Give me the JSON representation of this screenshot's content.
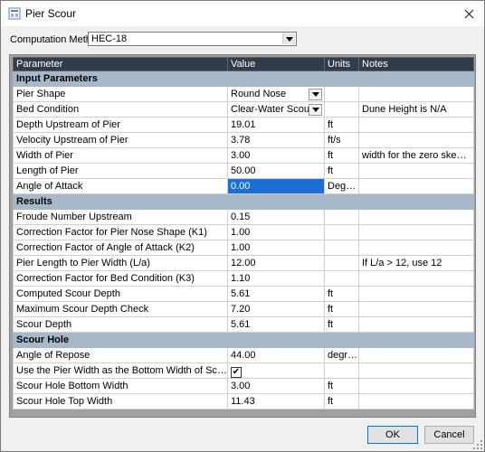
{
  "window": {
    "title": "Pier Scour"
  },
  "icons": {
    "app": "app-icon",
    "close": "close-icon",
    "dropdown": "chevron-down-icon",
    "check": "check-icon",
    "grip": "resize-grip-icon"
  },
  "computation": {
    "label": "Computation Method:",
    "value": "HEC-18"
  },
  "grid": {
    "headers": {
      "parameter": "Parameter",
      "value": "Value",
      "units": "Units",
      "notes": "Notes"
    },
    "sections": {
      "input": "Input Parameters",
      "results": "Results",
      "scour_hole": "Scour Hole"
    },
    "rows": {
      "pier_shape": {
        "p": "Pier Shape",
        "v": "Round Nose",
        "u": "",
        "n": ""
      },
      "bed_condition": {
        "p": "Bed Condition",
        "v": "Clear-Water Scour",
        "u": "",
        "n": "Dune Height is N/A"
      },
      "depth_upstream": {
        "p": "Depth Upstream of Pier",
        "v": "19.01",
        "u": "ft",
        "n": ""
      },
      "velocity_upstream": {
        "p": "Velocity Upstream of Pier",
        "v": "3.78",
        "u": "ft/s",
        "n": ""
      },
      "width_of_pier": {
        "p": "Width of Pier",
        "v": "3.00",
        "u": "ft",
        "n": "width for the zero skew co..."
      },
      "length_of_pier": {
        "p": "Length of Pier",
        "v": "50.00",
        "u": "ft",
        "n": ""
      },
      "angle_of_attack": {
        "p": "Angle of Attack",
        "v": "0.00",
        "u": "Degrees",
        "n": ""
      },
      "froude": {
        "p": "Froude Number Upstream",
        "v": "0.15",
        "u": "",
        "n": ""
      },
      "k1": {
        "p": "Correction Factor for Pier Nose Shape (K1)",
        "v": "1.00",
        "u": "",
        "n": ""
      },
      "k2": {
        "p": "Correction Factor of Angle of Attack (K2)",
        "v": "1.00",
        "u": "",
        "n": ""
      },
      "la": {
        "p": "Pier Length to Pier Width (L/a)",
        "v": "12.00",
        "u": "",
        "n": "If L/a > 12, use 12"
      },
      "k3": {
        "p": "Correction Factor for Bed Condition (K3)",
        "v": "1.10",
        "u": "",
        "n": ""
      },
      "computed_scour": {
        "p": "Computed Scour Depth",
        "v": "5.61",
        "u": "ft",
        "n": ""
      },
      "max_scour_check": {
        "p": "Maximum Scour Depth Check",
        "v": "7.20",
        "u": "ft",
        "n": ""
      },
      "scour_depth": {
        "p": "Scour Depth",
        "v": "5.61",
        "u": "ft",
        "n": ""
      },
      "angle_repose": {
        "p": "Angle of Repose",
        "v": "44.00",
        "u": "degrees",
        "n": ""
      },
      "use_pier_width": {
        "p": "Use the Pier Width as the Bottom Width of Scour Hole",
        "checked": true,
        "check_glyph": "✔",
        "u": "",
        "n": ""
      },
      "bottom_width": {
        "p": "Scour Hole Bottom Width",
        "v": "3.00",
        "u": "ft",
        "n": ""
      },
      "top_width": {
        "p": "Scour Hole Top Width",
        "v": "11.43",
        "u": "ft",
        "n": ""
      }
    }
  },
  "buttons": {
    "ok": "OK",
    "cancel": "Cancel"
  },
  "colors": {
    "header": "#323c48",
    "section": "#a7b8cb",
    "selected": "#1a6fd6"
  }
}
